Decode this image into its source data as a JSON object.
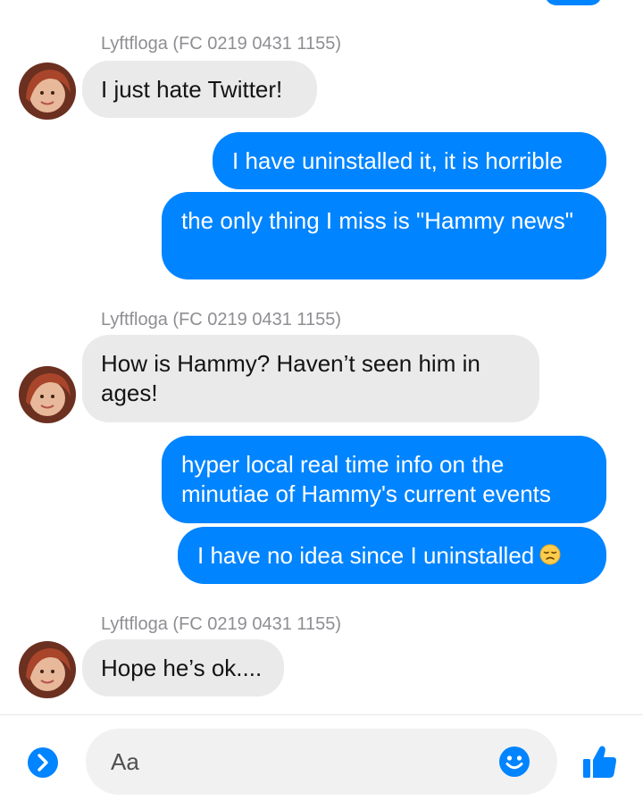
{
  "conversation": {
    "messages": [
      {
        "sender": "Lyftfloga (FC 0219 0431 1155)",
        "text": "I just hate Twitter!"
      },
      {
        "text": "I have uninstalled it, it is horrible"
      },
      {
        "text": "the only thing I miss is \"Hammy news\""
      },
      {
        "sender": "Lyftfloga (FC 0219 0431 1155)",
        "text": "How is Hammy? Haven’t seen him in ages!"
      },
      {
        "text": "hyper local real time info on the minutiae of Hammy's current events"
      },
      {
        "text": "I have no idea since I uninstalled",
        "emoji": "disappointed-face-emoji"
      },
      {
        "sender": "Lyftfloga (FC 0219 0431 1155)",
        "text": "Hope he’s ok...."
      }
    ]
  },
  "composer": {
    "placeholder": "Aa",
    "icons": {
      "expand": "chevron-right-icon",
      "emoji": "smiley-icon",
      "like": "thumbs-up-icon"
    }
  },
  "colors": {
    "outgoing_bubble": "#0084ff",
    "incoming_bubble": "#eaeaea",
    "sender_name": "#8e8e93"
  }
}
